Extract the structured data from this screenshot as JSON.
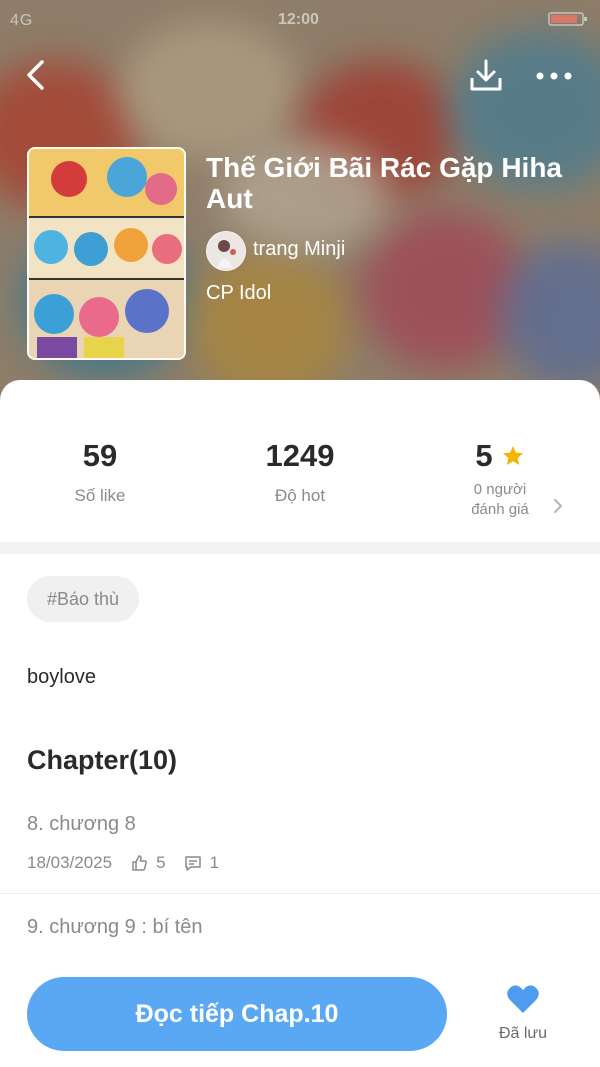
{
  "status_bar": {
    "network": "4G",
    "time": "12:00"
  },
  "book": {
    "title": "Thế Giới Bãi Rác Gặp Hiha Aut",
    "author": "trang Minji",
    "category": "CP Idol"
  },
  "stats": [
    {
      "value": "59",
      "label": "Số like"
    },
    {
      "value": "1249",
      "label": "Độ hot"
    },
    {
      "value": "5",
      "label_line1": "0 người",
      "label_line2": "đánh giá"
    }
  ],
  "tag": "#Báo thù",
  "description": "boylove",
  "chapters": {
    "heading": "Chapter(10)",
    "items": [
      {
        "name": "8. chương 8",
        "date": "18/03/2025",
        "likes": "5",
        "comments": "1"
      },
      {
        "name": "9. chương 9 : bí tên"
      }
    ]
  },
  "actions": {
    "read_label": "Đọc tiếp Chap.10",
    "saved_label": "Đã lưu"
  },
  "colors": {
    "accent": "#5aa8f4",
    "star": "#f5b400"
  }
}
